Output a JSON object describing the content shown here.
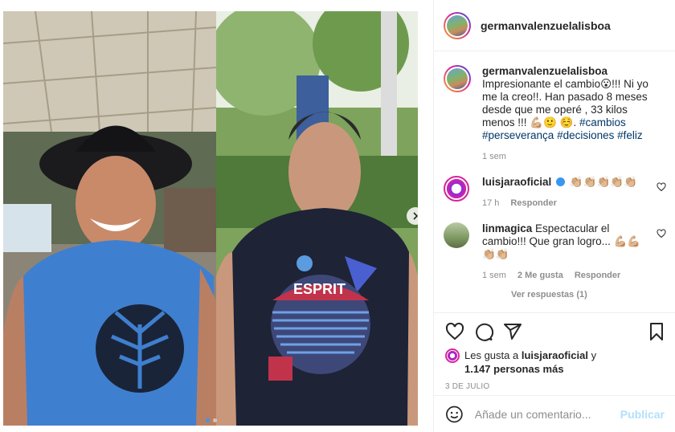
{
  "post": {
    "author": "germanvalenzuelalisboa",
    "caption_text": "Impresionante el cambio😮!!! Ni yo me la creo!!. Han pasado 8 meses desde que me operé , 33 kilos menos !!! 💪🏼🙂 ☺️.",
    "hashtags": [
      "#cambios",
      "#perseverança",
      "#decisiones",
      "#feliz"
    ],
    "caption_time": "1 sem",
    "photos": [
      {
        "shirt_text": ""
      },
      {
        "shirt_text": "ESPRIT"
      }
    ]
  },
  "comments": [
    {
      "author": "luisjaraoficial",
      "text": "👏🏼👏🏼👏🏼👏🏼👏🏼",
      "time": "17 h",
      "reply_label": "Responder"
    },
    {
      "author": "linmagica",
      "text": "Espectacular el cambio!!! Que gran logro... 💪🏼💪🏼👏🏼👏🏼",
      "time": "1 sem",
      "likes_label": "2 Me gusta",
      "reply_label": "Responder",
      "view_replies": "Ver respuestas (1)"
    }
  ],
  "likes": {
    "prefix": "Les gusta a",
    "user": "luisjaraoficial",
    "connector": "y",
    "others": "1.147 personas más"
  },
  "date": "3 DE JULIO",
  "composer": {
    "placeholder": "Añade un comentario...",
    "post_label": "Publicar"
  },
  "colors": {
    "accent_blue": "#3897f0",
    "hashtag": "#00376b",
    "muted": "#8e8e8e",
    "publish_disabled": "#b2dffc"
  }
}
